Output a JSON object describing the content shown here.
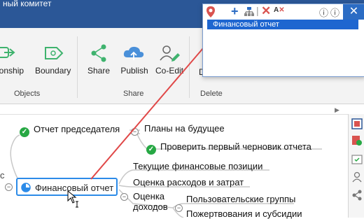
{
  "window": {
    "title": "ный комитет"
  },
  "ribbon": {
    "buttons": {
      "relationship": "ationship",
      "boundary": "Boundary",
      "share": "Share",
      "publish": "Publish",
      "coedit": "Co-Edit",
      "delete": "D"
    },
    "groups": {
      "objects": "Objects",
      "share": "Share",
      "delete": "Delete"
    }
  },
  "popup": {
    "item": "Финансовый отчет"
  },
  "mindmap": {
    "central": "Финансовый отчет",
    "branch_chairman": "Отчет председателя",
    "topic_plans": "Планы на будущее",
    "topic_draft": "Проверить первый черновик отчета",
    "topic_current": "Текущие финансовые позиции",
    "topic_costs": "Оценка расходов и затрат",
    "topic_income_line1": "Оценка",
    "topic_income_line2": "доходов",
    "topic_user_groups": "Пользовательские группы",
    "topic_donations": "Пожертвования и субсидии",
    "cut_letter": "с"
  },
  "colors": {
    "titlebar": "#2b5797",
    "accent": "#2c8be8",
    "arrow": "#e04848",
    "ribbon_icon": "#3fb36e",
    "check": "#27a844"
  }
}
